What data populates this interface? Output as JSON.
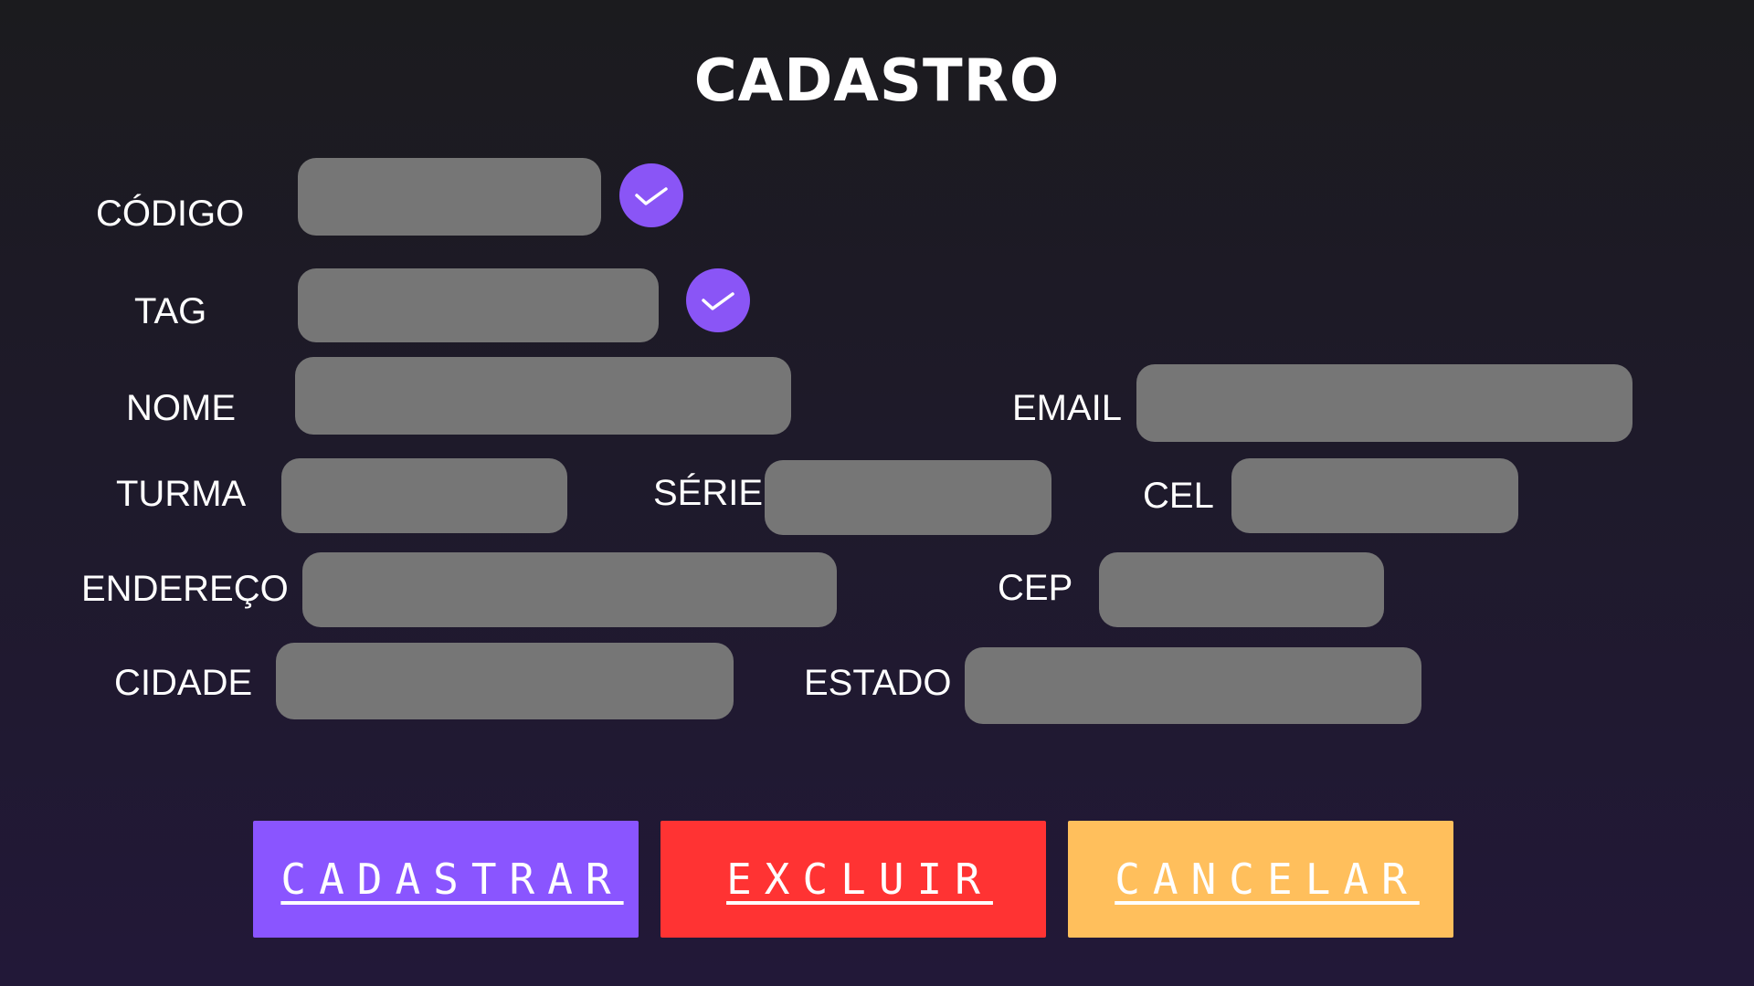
{
  "page": {
    "title": "CADASTRO"
  },
  "form": {
    "codigo": {
      "label": "CÓDIGO",
      "value": ""
    },
    "tag": {
      "label": "TAG",
      "value": ""
    },
    "nome": {
      "label": "NOME",
      "value": ""
    },
    "email": {
      "label": "EMAIL",
      "value": ""
    },
    "turma": {
      "label": "TURMA",
      "value": ""
    },
    "serie": {
      "label": "SÉRIE",
      "value": ""
    },
    "cel": {
      "label": "CEL",
      "value": ""
    },
    "endereco": {
      "label": "ENDEREÇO",
      "value": ""
    },
    "cep": {
      "label": "CEP",
      "value": ""
    },
    "cidade": {
      "label": "CIDADE",
      "value": ""
    },
    "estado": {
      "label": "ESTADO",
      "value": ""
    }
  },
  "icons": {
    "confirm": "check-icon"
  },
  "buttons": {
    "cadastrar": {
      "label": "CADASTRAR",
      "color": "#8a55ff"
    },
    "excluir": {
      "label": "EXCLUIR",
      "color": "#ff3333"
    },
    "cancelar": {
      "label": "CANCELAR",
      "color": "#ffbf5c"
    }
  },
  "colors": {
    "accent": "#8a55f6",
    "field": "#767676",
    "background_top": "#1b1b1e",
    "background_bottom": "#221838"
  }
}
